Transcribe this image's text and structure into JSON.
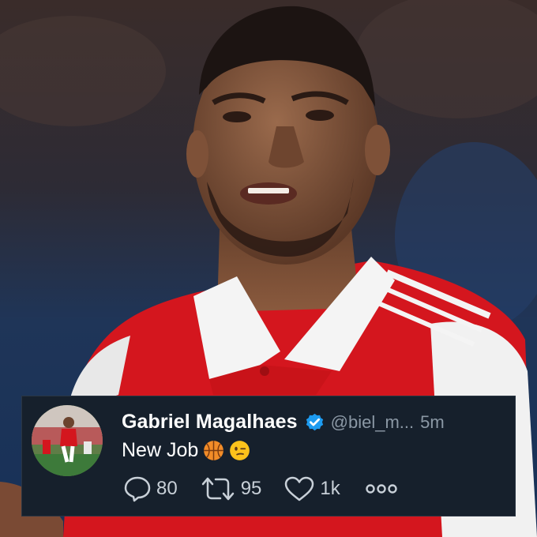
{
  "tweet": {
    "display_name": "Gabriel Magalhaes",
    "handle": "@biel_m...",
    "time": "5m",
    "text": "New Job",
    "replies": "80",
    "retweets": "95",
    "likes": "1k"
  },
  "colors": {
    "card_background": "#16202c",
    "verified_blue": "#1d9bf0",
    "secondary_text": "#8b98a5",
    "kit_red": "#d4161e"
  },
  "icons": [
    "verified-badge-icon",
    "basketball-emoji-icon",
    "winking-face-emoji-icon",
    "reply-icon",
    "retweet-icon",
    "like-icon",
    "more-icon"
  ]
}
